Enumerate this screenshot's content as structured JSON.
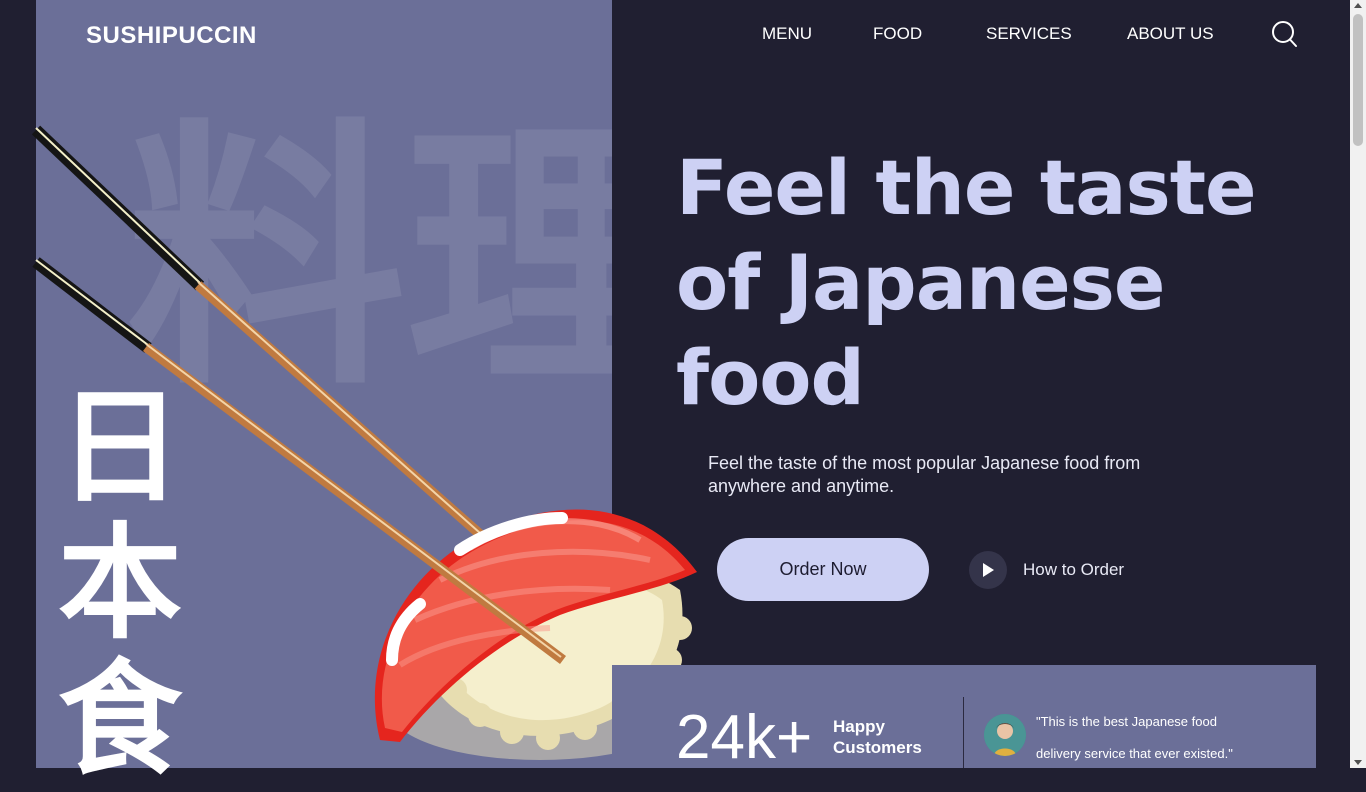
{
  "brand": {
    "name": "SUSHIPUCCIN"
  },
  "nav": {
    "items": [
      {
        "label": "MENU"
      },
      {
        "label": "FOOD"
      },
      {
        "label": "SERVICES"
      },
      {
        "label": "ABOUT US"
      }
    ],
    "search_icon": "search-icon"
  },
  "hero": {
    "background_kanji": "料理",
    "vertical_kanji": [
      "日",
      "本",
      "食"
    ],
    "headline": "Feel the taste of Japanese food",
    "subtitle": "Feel the taste of the most popular Japanese food from anywhere and anytime.",
    "order_button": "Order Now",
    "how_to_order": "How to Order"
  },
  "stats": {
    "number": "24k+",
    "label": "Happy Customers"
  },
  "testimonial": {
    "quote": "\"This is the best Japanese food delivery service that ever existed.\""
  },
  "colors": {
    "background": "#201f31",
    "panel": "#6b6f98",
    "accent": "#cdd1f4",
    "salmon": "#f15a4a",
    "rice": "#f3efc9"
  }
}
